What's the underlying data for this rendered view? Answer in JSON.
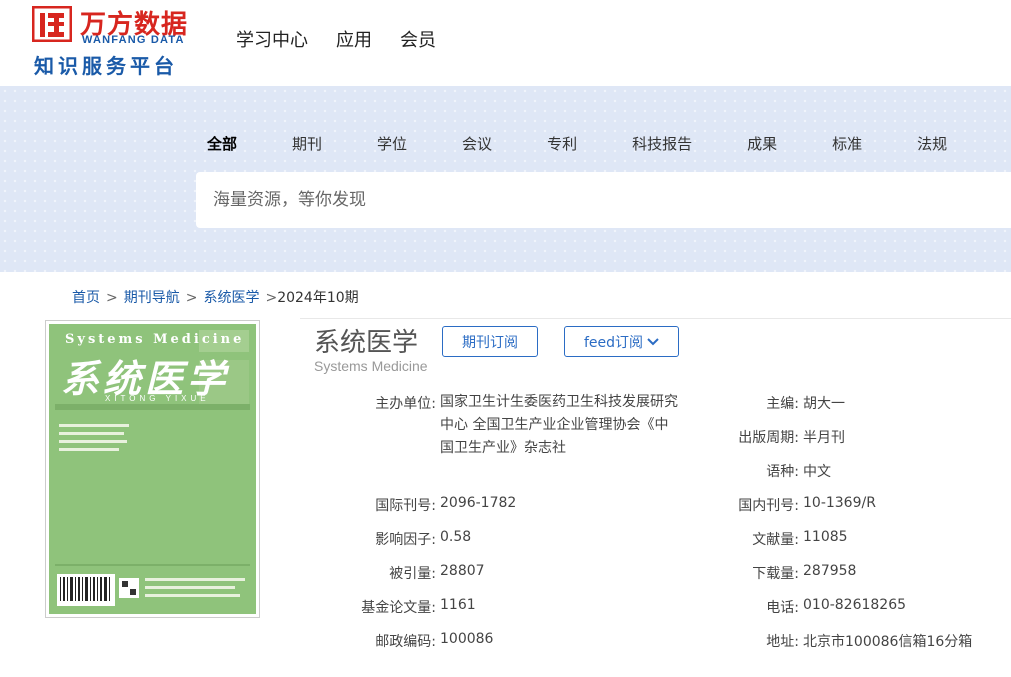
{
  "logo": {
    "cn": "万方数据",
    "en": "WANFANG DATA",
    "sub": "知识服务平台"
  },
  "top_nav": [
    "学习中心",
    "应用",
    "会员"
  ],
  "categories": [
    "全部",
    "期刊",
    "学位",
    "会议",
    "专利",
    "科技报告",
    "成果",
    "标准",
    "法规"
  ],
  "search": {
    "placeholder": "海量资源，等你发现"
  },
  "breadcrumb": {
    "home": "首页",
    "journal_nav": "期刊导航",
    "journal": "系统医学",
    "issue": "2024年10期"
  },
  "journal": {
    "title": "系统医学",
    "title_en": "Systems Medicine",
    "subscribe_label": "期刊订阅",
    "feed_label": "feed订阅"
  },
  "info": {
    "sponsor_label": "主办单位:",
    "sponsor_value": "国家卫生计生委医药卫生科技发展研究中心 全国卫生产业企业管理协会《中国卫生产业》杂志社",
    "editor_label": "主编:",
    "editor_value": "胡大一",
    "cycle_label": "出版周期:",
    "cycle_value": "半月刊",
    "lang_label": "语种:",
    "lang_value": "中文",
    "issn_label": "国际刊号:",
    "issn_value": "2096-1782",
    "cn_label": "国内刊号:",
    "cn_value": "10-1369/R",
    "if_label": "影响因子:",
    "if_value": "0.58",
    "docs_label": "文献量:",
    "docs_value": "11085",
    "cited_label": "被引量:",
    "cited_value": "28807",
    "downloads_label": "下载量:",
    "downloads_value": "287958",
    "fund_label": "基金论文量:",
    "fund_value": "1161",
    "phone_label": "电话:",
    "phone_value": "010-82618265",
    "zip_label": "邮政编码:",
    "zip_value": "100086",
    "addr_label": "地址:",
    "addr_value": "北京市100086信箱16分箱"
  },
  "cover": {
    "title_en": "Systems Medicine",
    "title_cn": "系统医学",
    "pinyin": "XITONG YIXUE"
  }
}
